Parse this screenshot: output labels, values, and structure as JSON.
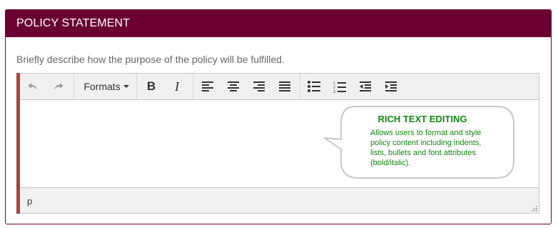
{
  "panel": {
    "title": "POLICY STATEMENT",
    "description": "Briefly describe how the purpose of the policy will be fulfilled.",
    "header_color": "#6a0032"
  },
  "editor": {
    "toolbar": {
      "undo_icon": "undo-icon",
      "redo_icon": "redo-icon",
      "formats_label": "Formats",
      "bold_label": "B",
      "italic_label": "I",
      "align_left_icon": "align-left-icon",
      "align_center_icon": "align-center-icon",
      "align_right_icon": "align-right-icon",
      "align_justify_icon": "align-justify-icon",
      "bullet_list_icon": "bullet-list-icon",
      "numbered_list_icon": "numbered-list-icon",
      "outdent_icon": "outdent-icon",
      "indent_icon": "indent-icon"
    },
    "content": "",
    "status_path": "p",
    "accent_color": "#a94442"
  },
  "callout": {
    "title": "RICH TEXT EDITING",
    "text": "Allows users to format and style policy content including indents, lists, bullets and font attributes (bold/italic).",
    "color": "#118811"
  }
}
